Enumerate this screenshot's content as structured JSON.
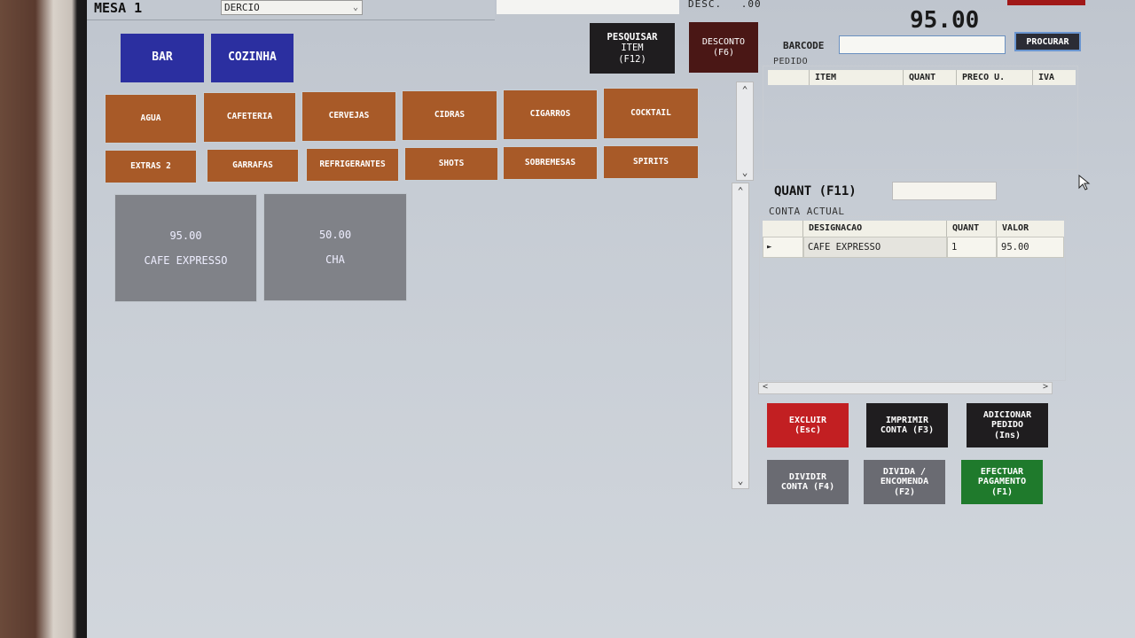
{
  "header": {
    "table_label": "MESA 1",
    "waiter": "DERCIO",
    "desc_label": "DESC.",
    "desc_value": ".00",
    "total": "95.00"
  },
  "main_categories": [
    "BAR",
    "COZINHA"
  ],
  "toolbar": {
    "search_item_line1": "PESQUISAR",
    "search_item_line2": "ITEM",
    "search_item_line3": "(F12)",
    "discount_line1": "DESCONTO",
    "discount_line2": "(F6)"
  },
  "subcategories": [
    "AGUA",
    "CAFETERIA",
    "CERVEJAS",
    "CIDRAS",
    "CIGARROS",
    "COCKTAIL",
    "EXTRAS 2",
    "GARRAFAS",
    "REFRIGERANTES",
    "SHOTS",
    "SOBREMESAS",
    "SPIRITS"
  ],
  "products": [
    {
      "price": "95.00",
      "name": "CAFE EXPRESSO"
    },
    {
      "price": "50.00",
      "name": "CHA"
    }
  ],
  "barcode": {
    "label": "BARCODE",
    "value": "",
    "search_button": "PROCURAR"
  },
  "order": {
    "group_label": "PEDIDO",
    "columns": [
      "ITEM",
      "QUANT",
      "PRECO U.",
      "IVA"
    ]
  },
  "quantity": {
    "label": "QUANT (F11)",
    "value": ""
  },
  "current_account": {
    "group_label": "CONTA ACTUAL",
    "columns": [
      "DESIGNACAO",
      "QUANT",
      "VALOR"
    ],
    "rows": [
      {
        "designation": "CAFE EXPRESSO",
        "quant": "1",
        "value": "95.00"
      }
    ]
  },
  "actions": {
    "delete_l1": "EXCLUIR",
    "delete_l2": "(Esc)",
    "print_l1": "IMPRIMIR",
    "print_l2": "CONTA (F3)",
    "add_l1": "ADICIONAR",
    "add_l2": "PEDIDO",
    "add_l3": "(Ins)",
    "split_l1": "DIVIDIR",
    "split_l2": "CONTA (F4)",
    "debt_l1": "DIVIDA /",
    "debt_l2": "ENCOMENDA",
    "debt_l3": "(F2)",
    "pay_l1": "EFECTUAR",
    "pay_l2": "PAGAMENTO",
    "pay_l3": "(F1)"
  },
  "colors": {
    "category_blue": "#2b2fa0",
    "subcategory_brown": "#a85a28",
    "delete_red": "#c21f22",
    "pay_green": "#1f7a2c",
    "gray_button": "#6a6b72",
    "dark_button": "#1f1d1f"
  }
}
